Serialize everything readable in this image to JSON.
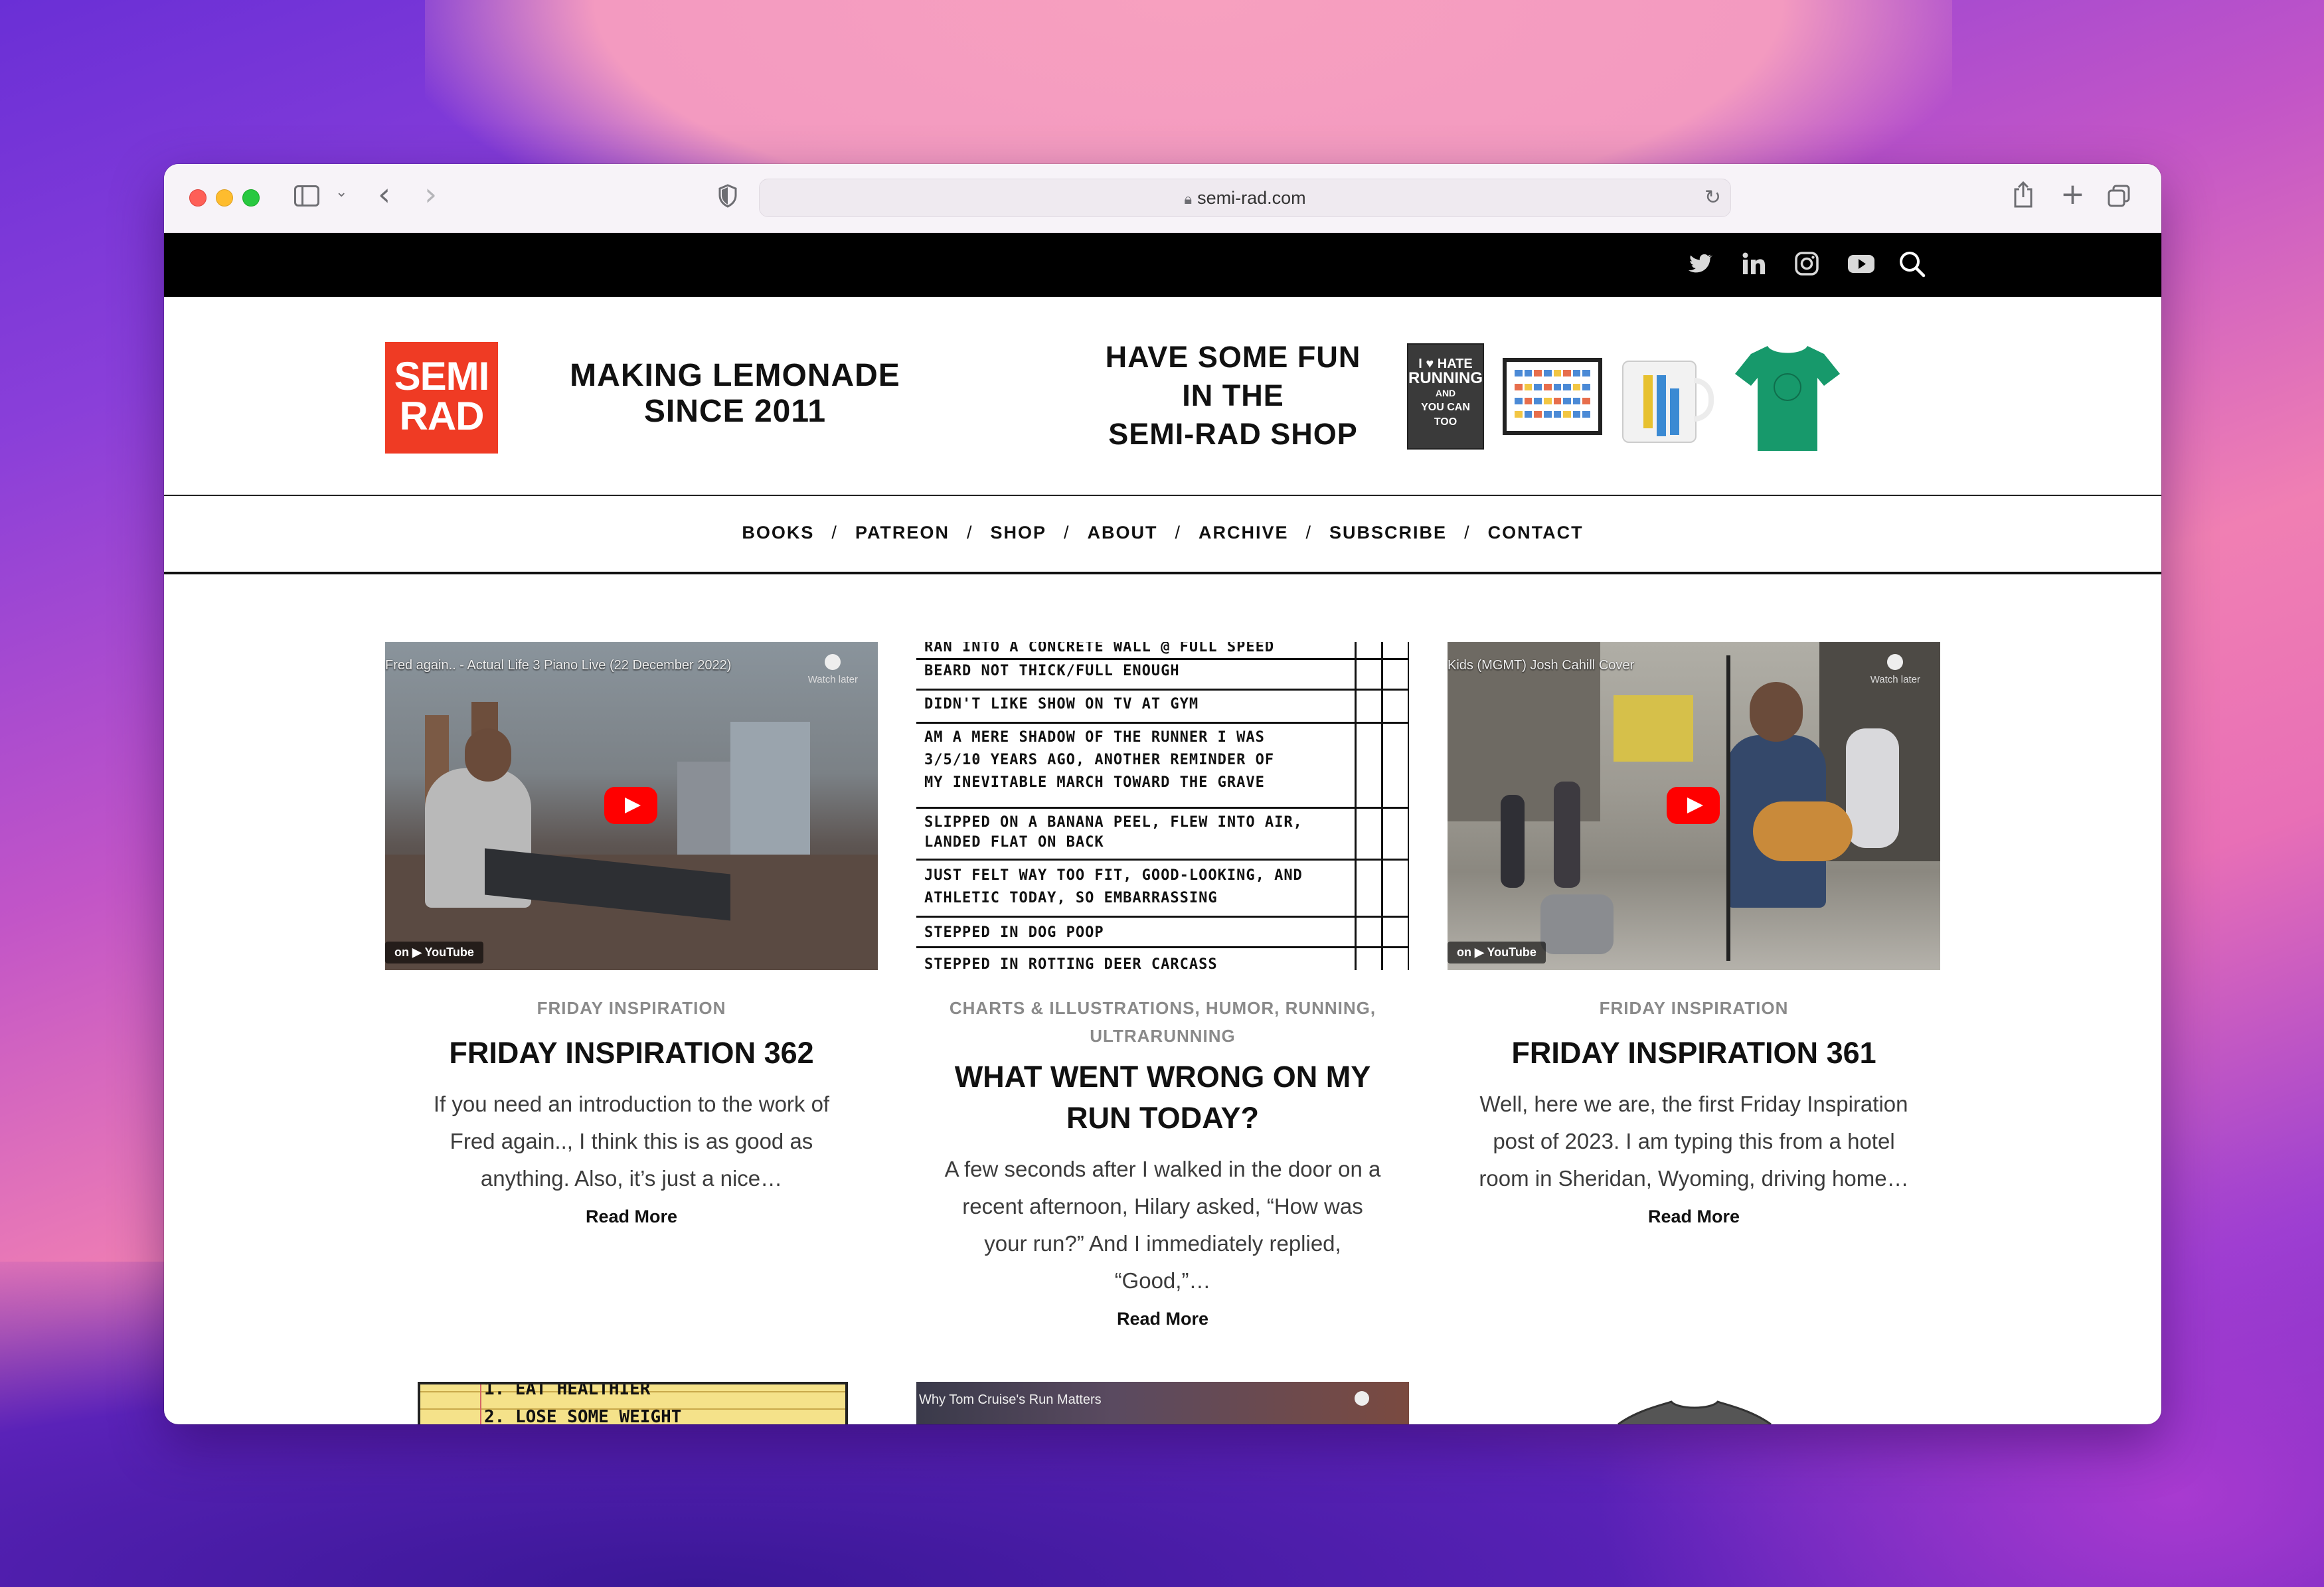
{
  "browser": {
    "url": "semi-rad.com"
  },
  "site": {
    "logo": {
      "line1": "SEMI",
      "line2": "RAD"
    },
    "tagline": {
      "line1": "MAKING LEMONADE",
      "line2": "SINCE 2011"
    },
    "shop_promo": {
      "line1": "HAVE SOME FUN",
      "line2": "IN THE",
      "line3": "SEMI-RAD SHOP"
    },
    "book_cover": {
      "line1": "I ♥ HATE",
      "line2": "RUNNING",
      "line3": "AND",
      "line4": "YOU CAN TOO"
    }
  },
  "nav": {
    "items": [
      "BOOKS",
      "PATREON",
      "SHOP",
      "ABOUT",
      "ARCHIVE",
      "SUBSCRIBE",
      "CONTACT"
    ],
    "separator": "/"
  },
  "posts": [
    {
      "video_title": "Fred again.. - Actual Life 3 Piano Live (22 December 2022)",
      "watch_later": "Watch later",
      "youtube_label": "on ▶ YouTube",
      "category": "FRIDAY INSPIRATION",
      "title": "FRIDAY INSPIRATION 362",
      "excerpt": "If you need an introduction to the work of Fred again.., I think this is as good as anything. Also, it’s just a nice…",
      "read_more": "Read More"
    },
    {
      "chart_rows": [
        "RAN INTO A CONCRETE WALL @ FULL SPEED",
        "BEARD NOT THICK/FULL ENOUGH",
        "DIDN'T LIKE SHOW ON TV AT GYM",
        "AM A MERE SHADOW OF THE RUNNER I WAS",
        "3/5/10 YEARS AGO, ANOTHER REMINDER OF",
        "MY INEVITABLE MARCH TOWARD THE GRAVE",
        "SLIPPED ON A BANANA PEEL, FLEW INTO AIR,",
        "LANDED FLAT ON BACK",
        "JUST FELT WAY TOO FIT, GOOD-LOOKING, AND",
        "ATHLETIC TODAY, SO EMBARRASSING",
        "STEPPED IN DOG POOP",
        "STEPPED IN ROTTING DEER CARCASS"
      ],
      "category": "CHARTS & ILLUSTRATIONS, HUMOR, RUNNING, ULTRARUNNING",
      "title": "WHAT WENT WRONG ON MY RUN TODAY?",
      "excerpt": "A few seconds after I walked in the door on a recent afternoon, Hilary asked, “How was your run?” And I immediately replied, “Good,”…",
      "read_more": "Read More"
    },
    {
      "video_title": "Kids (MGMT) Josh Cahill Cover",
      "watch_later": "Watch later",
      "youtube_label": "on ▶ YouTube",
      "category": "FRIDAY INSPIRATION",
      "title": "FRIDAY INSPIRATION 361",
      "excerpt": "Well, here we are, the first Friday Inspiration post of 2023. I am typing this from a hotel room in Sheridan, Wyoming, driving home…",
      "read_more": "Read More"
    }
  ],
  "next_row": {
    "notepad_lines": [
      "1. EAT HEALTHIER",
      "2. LOSE SOME WEIGHT"
    ],
    "video_title": "Why Tom Cruise's Run Matters"
  },
  "colors": {
    "brand_red": "#ef3b24",
    "topbar": "#000000",
    "shirt_green": "#17996b"
  }
}
